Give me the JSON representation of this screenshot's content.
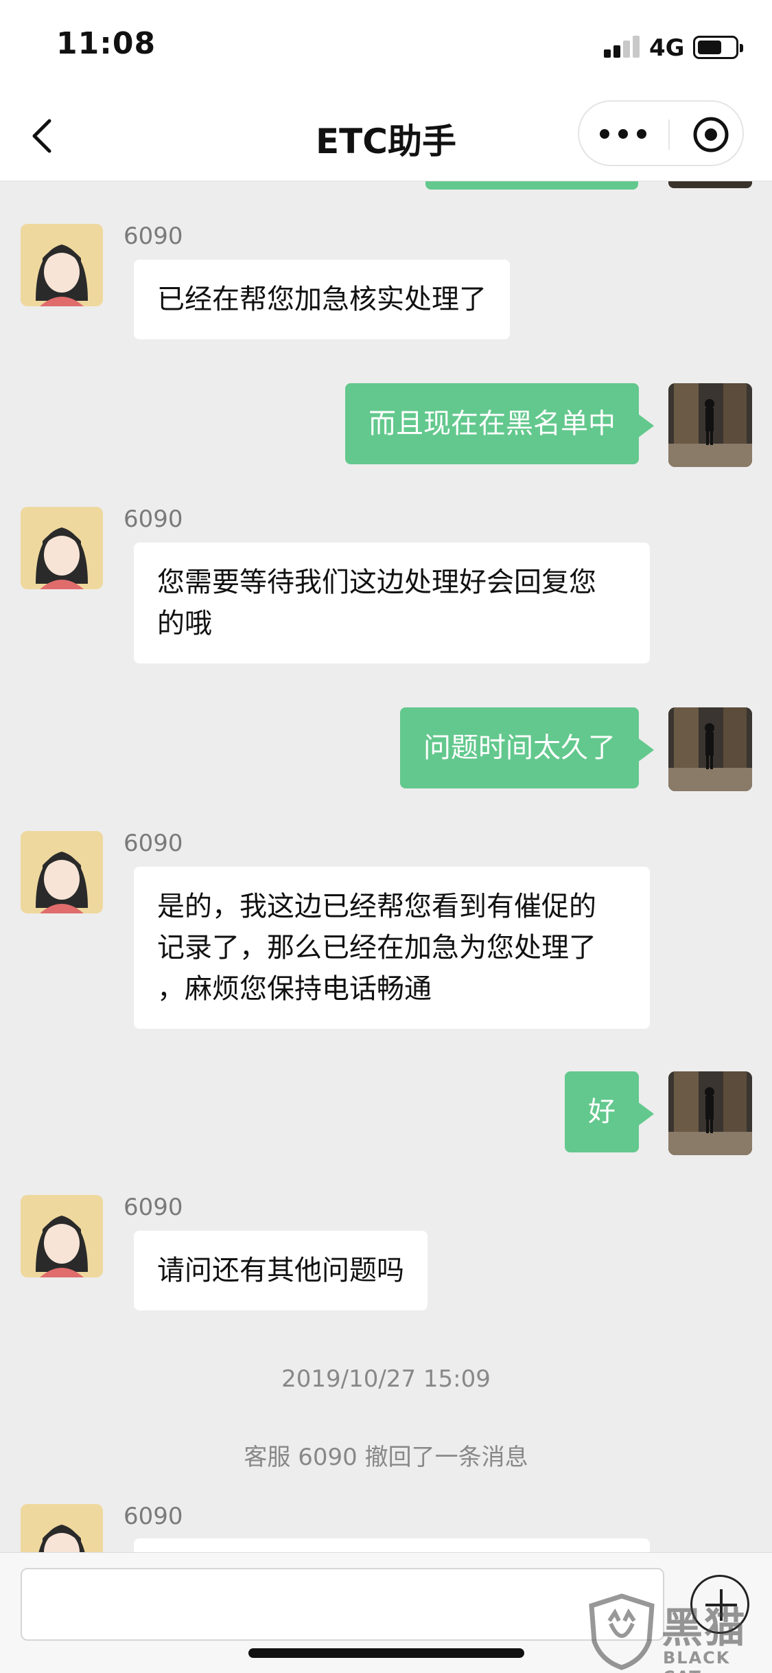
{
  "status_bar": {
    "time": "11:08",
    "network": "4G"
  },
  "nav": {
    "title": "ETC助手"
  },
  "messages": [
    {
      "side": "left",
      "sender": "6090",
      "text": "已经在帮您加急核实处理了"
    },
    {
      "side": "right",
      "text": "而且现在在黑名单中"
    },
    {
      "side": "left",
      "sender": "6090",
      "lines": [
        "您需要等待我们这边处理好会回复您",
        "的哦"
      ]
    },
    {
      "side": "right",
      "text": "问题时间太久了"
    },
    {
      "side": "left",
      "sender": "6090",
      "lines": [
        "是的，我这边已经帮您看到有催促的",
        "记录了，那么已经在加急为您处理了",
        "，麻烦您保持电话畅通"
      ]
    },
    {
      "side": "right",
      "text": "好"
    },
    {
      "side": "left",
      "sender": "6090",
      "text": "请问还有其他问题吗"
    },
    {
      "side": "left",
      "sender": "6090",
      "text": ""
    }
  ],
  "system": {
    "timestamp": "2019/10/27 15:09",
    "recall_note": "客服 6090 撤回了一条消息"
  },
  "input": {
    "placeholder": ""
  },
  "watermark": {
    "cn": "黑猫",
    "en": "BLACK CAT"
  }
}
